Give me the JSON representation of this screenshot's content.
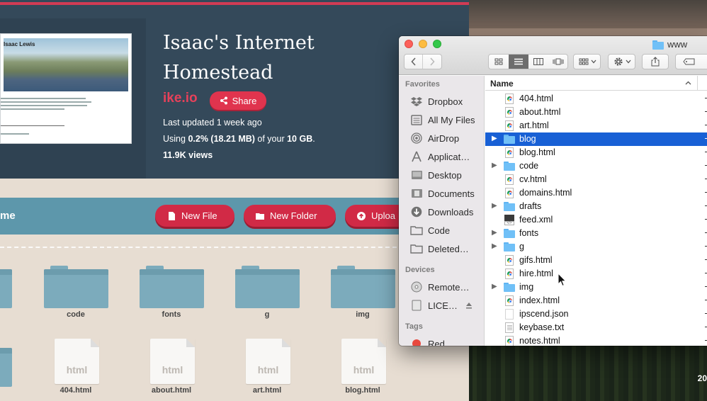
{
  "page": {
    "thumbnail": {
      "name": "Isaac Lewis"
    },
    "site_title": "Isaac's Internet Homestead",
    "domain": "ike.io",
    "share_label": "Share",
    "info": {
      "updated": "Last updated 1 week ago",
      "usage_prefix": "Using ",
      "usage_bold": "0.2% (18.21 MB)",
      "usage_mid": " of your ",
      "usage_quota": "10 GB",
      "usage_suffix": ".",
      "views": "11.9K views"
    },
    "toolbar": {
      "label": "me",
      "new_file": "New File",
      "new_folder": "New Folder",
      "upload": "Uploa"
    },
    "grid_items": [
      {
        "name": "code",
        "kind": "folder"
      },
      {
        "name": "fonts",
        "kind": "folder"
      },
      {
        "name": "g",
        "kind": "folder"
      },
      {
        "name": "img",
        "kind": "folder"
      },
      {
        "name": "404.html",
        "kind": "file",
        "ext": "html"
      },
      {
        "name": "about.html",
        "kind": "file",
        "ext": "html"
      },
      {
        "name": "art.html",
        "kind": "file",
        "ext": "html"
      },
      {
        "name": "blog.html",
        "kind": "file",
        "ext": "html"
      }
    ]
  },
  "finder": {
    "title": "www",
    "sidebar": {
      "favorites_heading": "Favorites",
      "favorites": [
        {
          "label": "Dropbox",
          "icon": "dropbox-icon"
        },
        {
          "label": "All My Files",
          "icon": "all-files-icon"
        },
        {
          "label": "AirDrop",
          "icon": "airdrop-icon"
        },
        {
          "label": "Applicat…",
          "icon": "applications-icon"
        },
        {
          "label": "Desktop",
          "icon": "desktop-icon"
        },
        {
          "label": "Documents",
          "icon": "documents-icon"
        },
        {
          "label": "Downloads",
          "icon": "downloads-icon"
        },
        {
          "label": "Code",
          "icon": "folder-icon"
        },
        {
          "label": "Deleted…",
          "icon": "folder-icon"
        }
      ],
      "devices_heading": "Devices",
      "devices": [
        {
          "label": "Remote…",
          "icon": "remote-disc-icon"
        },
        {
          "label": "LICE…",
          "icon": "drive-icon"
        }
      ],
      "tags_heading": "Tags",
      "tags": [
        {
          "label": "Red",
          "color": "#e8483e"
        }
      ]
    },
    "list": {
      "column_name": "Name",
      "rows": [
        {
          "name": "404.html",
          "type": "html"
        },
        {
          "name": "about.html",
          "type": "html"
        },
        {
          "name": "art.html",
          "type": "html"
        },
        {
          "name": "blog",
          "type": "folder",
          "selected": true
        },
        {
          "name": "blog.html",
          "type": "html"
        },
        {
          "name": "code",
          "type": "folder"
        },
        {
          "name": "cv.html",
          "type": "html"
        },
        {
          "name": "domains.html",
          "type": "html"
        },
        {
          "name": "drafts",
          "type": "folder"
        },
        {
          "name": "feed.xml",
          "type": "xml"
        },
        {
          "name": "fonts",
          "type": "folder"
        },
        {
          "name": "g",
          "type": "folder"
        },
        {
          "name": "gifs.html",
          "type": "html"
        },
        {
          "name": "hire.html",
          "type": "html"
        },
        {
          "name": "img",
          "type": "folder"
        },
        {
          "name": "index.html",
          "type": "html"
        },
        {
          "name": "ipscend.json",
          "type": "blank"
        },
        {
          "name": "keybase.txt",
          "type": "text"
        },
        {
          "name": "notes.html",
          "type": "html"
        }
      ]
    }
  },
  "desktop": {
    "clock_fragment": "20"
  },
  "colors": {
    "accent_red": "#d12a46",
    "hero_bg": "#34495a",
    "band_bg": "#5d97ab",
    "finder_selection": "#1860d5"
  }
}
